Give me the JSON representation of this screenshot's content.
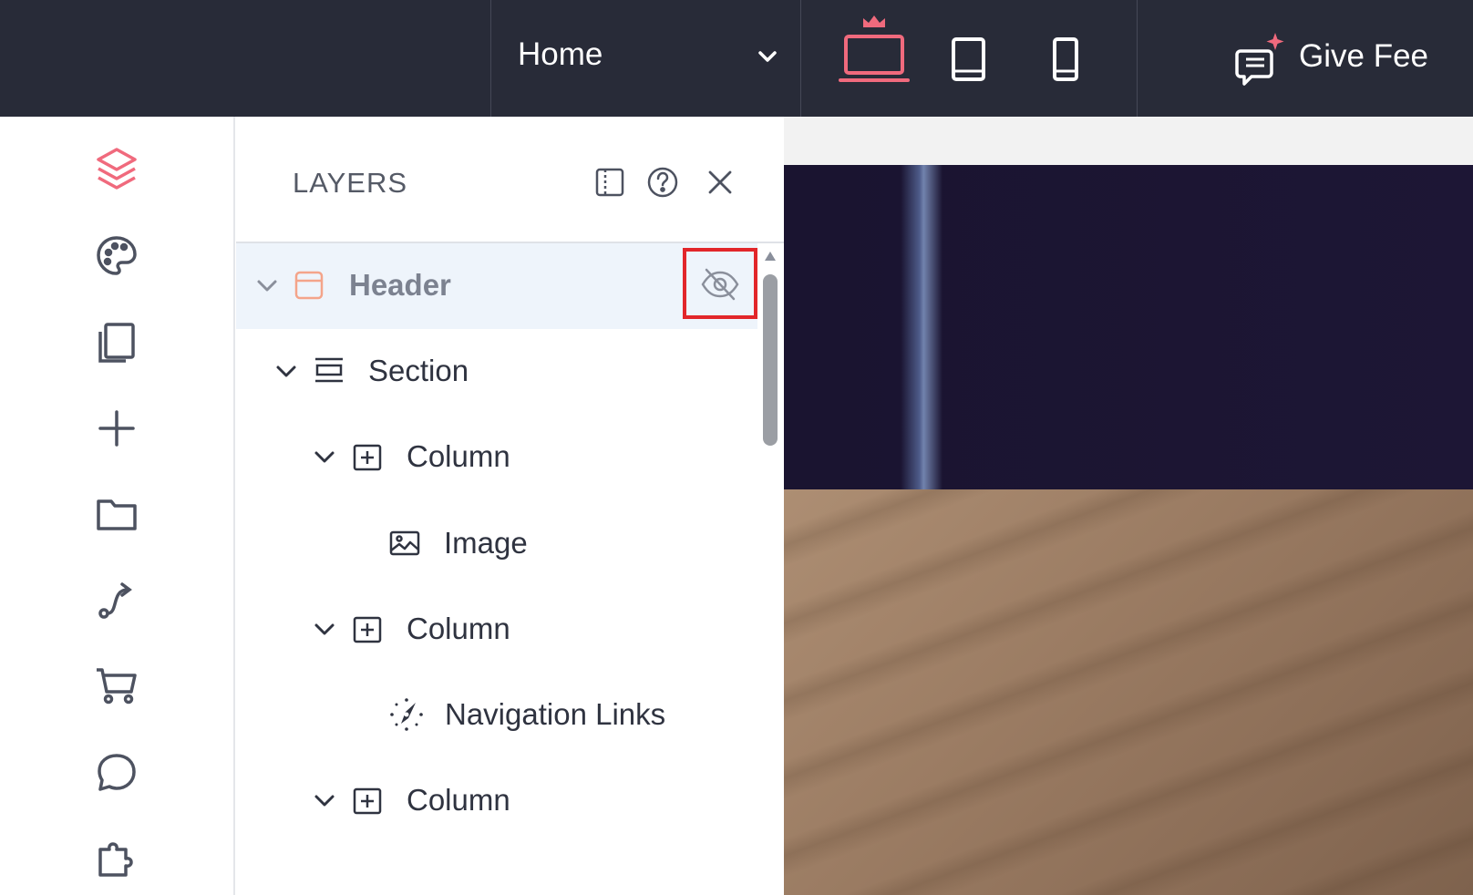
{
  "topbar": {
    "page_selector": {
      "label": "Home"
    },
    "devices": [
      {
        "name": "desktop",
        "icon": "laptop-crown-icon",
        "active": true
      },
      {
        "name": "tablet",
        "icon": "tablet-icon",
        "active": false
      },
      {
        "name": "mobile",
        "icon": "phone-icon",
        "active": false
      }
    ],
    "feedback": {
      "label": "Give Fee",
      "icon": "feedback-sparkle-icon"
    },
    "colors": {
      "background": "#282b38",
      "accent": "#f06a7d"
    }
  },
  "rail": {
    "items": [
      {
        "icon": "layers-icon",
        "active": true
      },
      {
        "icon": "palette-icon"
      },
      {
        "icon": "pages-icon"
      },
      {
        "icon": "add-icon"
      },
      {
        "icon": "folder-icon"
      },
      {
        "icon": "workflow-icon"
      },
      {
        "icon": "cart-icon"
      },
      {
        "icon": "comment-icon"
      },
      {
        "icon": "puzzle-icon"
      }
    ]
  },
  "layers_panel": {
    "title": "LAYERS",
    "header_buttons": [
      "dock-panel-icon",
      "help-icon",
      "close-icon"
    ],
    "tree": [
      {
        "label": "Header",
        "icon": "header-icon",
        "expanded": true,
        "selected": true,
        "hidden_toggle": "eye-off-icon"
      },
      {
        "label": "Section",
        "icon": "section-icon",
        "expanded": true
      },
      {
        "label": "Column",
        "icon": "column-icon",
        "expanded": true
      },
      {
        "label": "Image",
        "icon": "image-icon"
      },
      {
        "label": "Column",
        "icon": "column-icon",
        "expanded": true
      },
      {
        "label": "Navigation Links",
        "icon": "navigation-icon"
      },
      {
        "label": "Column",
        "icon": "column-icon",
        "expanded": true
      }
    ]
  }
}
